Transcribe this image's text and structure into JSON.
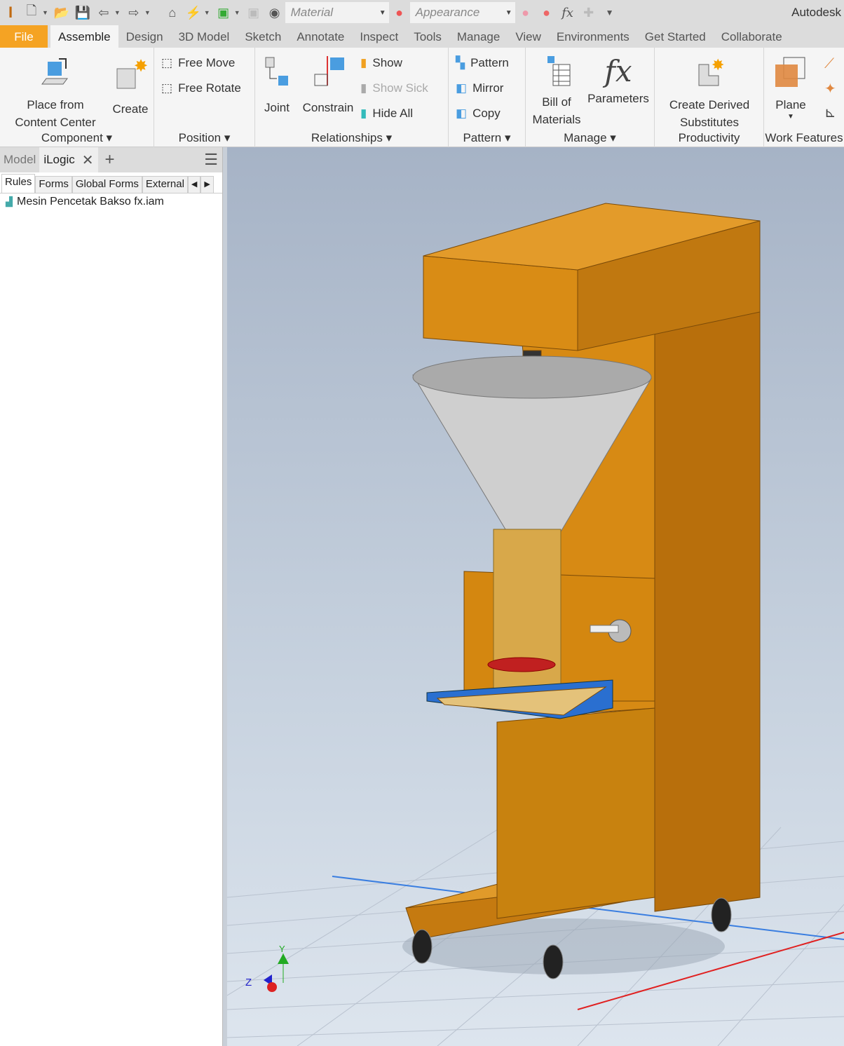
{
  "qat": {
    "material_placeholder": "Material",
    "appearance_placeholder": "Appearance",
    "app_title": "Autodesk"
  },
  "tabs": [
    "File",
    "Assemble",
    "Design",
    "3D Model",
    "Sketch",
    "Annotate",
    "Inspect",
    "Tools",
    "Manage",
    "View",
    "Environments",
    "Get Started",
    "Collaborate"
  ],
  "ribbon": {
    "component": {
      "title": "Component",
      "place": "Place from",
      "place2": "Content Center",
      "create": "Create"
    },
    "position": {
      "title": "Position",
      "free_move": "Free Move",
      "free_rotate": "Free Rotate"
    },
    "relationships": {
      "title": "Relationships",
      "joint": "Joint",
      "constrain": "Constrain",
      "show": "Show",
      "show_sick": "Show Sick",
      "hide_all": "Hide All"
    },
    "pattern": {
      "title": "Pattern",
      "pattern": "Pattern",
      "mirror": "Mirror",
      "copy": "Copy"
    },
    "manage": {
      "title": "Manage",
      "bom": "Bill of",
      "bom2": "Materials",
      "parameters": "Parameters"
    },
    "productivity": {
      "title": "Productivity",
      "cds": "Create Derived",
      "cds2": "Substitutes"
    },
    "work": {
      "title": "Work Features",
      "plane": "Plane"
    }
  },
  "browser": {
    "tab_model": "Model",
    "tab_ilogic": "iLogic",
    "subtabs": [
      "Rules",
      "Forms",
      "Global Forms",
      "External"
    ],
    "item": "Mesin Pencetak Bakso fx.iam"
  },
  "viewcube": {
    "y": "Y",
    "z": "Z"
  },
  "colors": {
    "accent": "#f5a323",
    "body": "#d98a14"
  }
}
